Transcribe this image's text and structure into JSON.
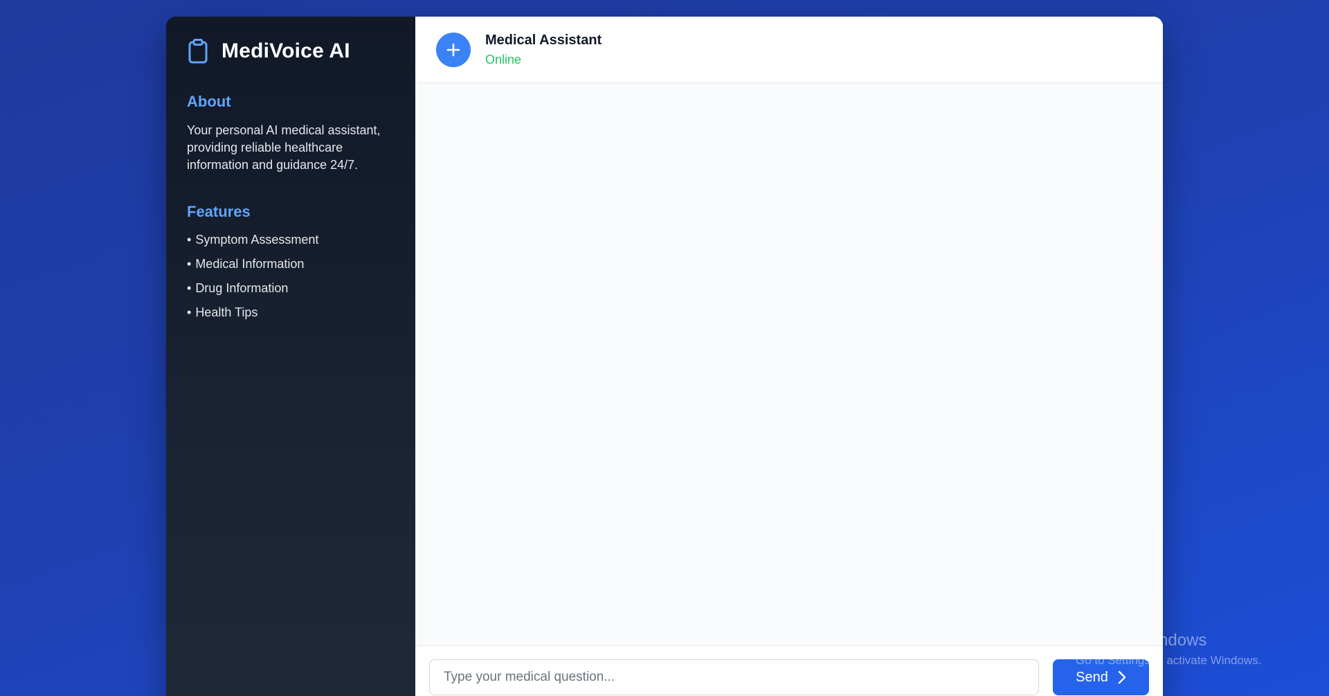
{
  "sidebar": {
    "brand_title": "MediVoice AI",
    "brand_icon": "clipboard-icon",
    "about_heading": "About",
    "about_text": "Your personal AI medical assistant, providing reliable healthcare information and guidance 24/7.",
    "features_heading": "Features",
    "features": [
      {
        "label": "Symptom Assessment"
      },
      {
        "label": "Medical Information"
      },
      {
        "label": "Drug Information"
      },
      {
        "label": "Health Tips"
      }
    ],
    "bullet": "•"
  },
  "header": {
    "avatar_icon": "plus-icon",
    "name": "Medical Assistant",
    "status": "Online"
  },
  "input": {
    "placeholder": "Type your medical question...",
    "value": "",
    "send_label": "Send",
    "send_icon": "chevron-right-icon"
  },
  "watermark": {
    "title": "Activate Windows",
    "subtitle": "Go to Settings to activate Windows."
  },
  "colors": {
    "accent": "#3b82f6",
    "button": "#2563eb",
    "heading": "#60a5fa",
    "status_online": "#22c55e",
    "sidebar_bg": "#111827"
  }
}
